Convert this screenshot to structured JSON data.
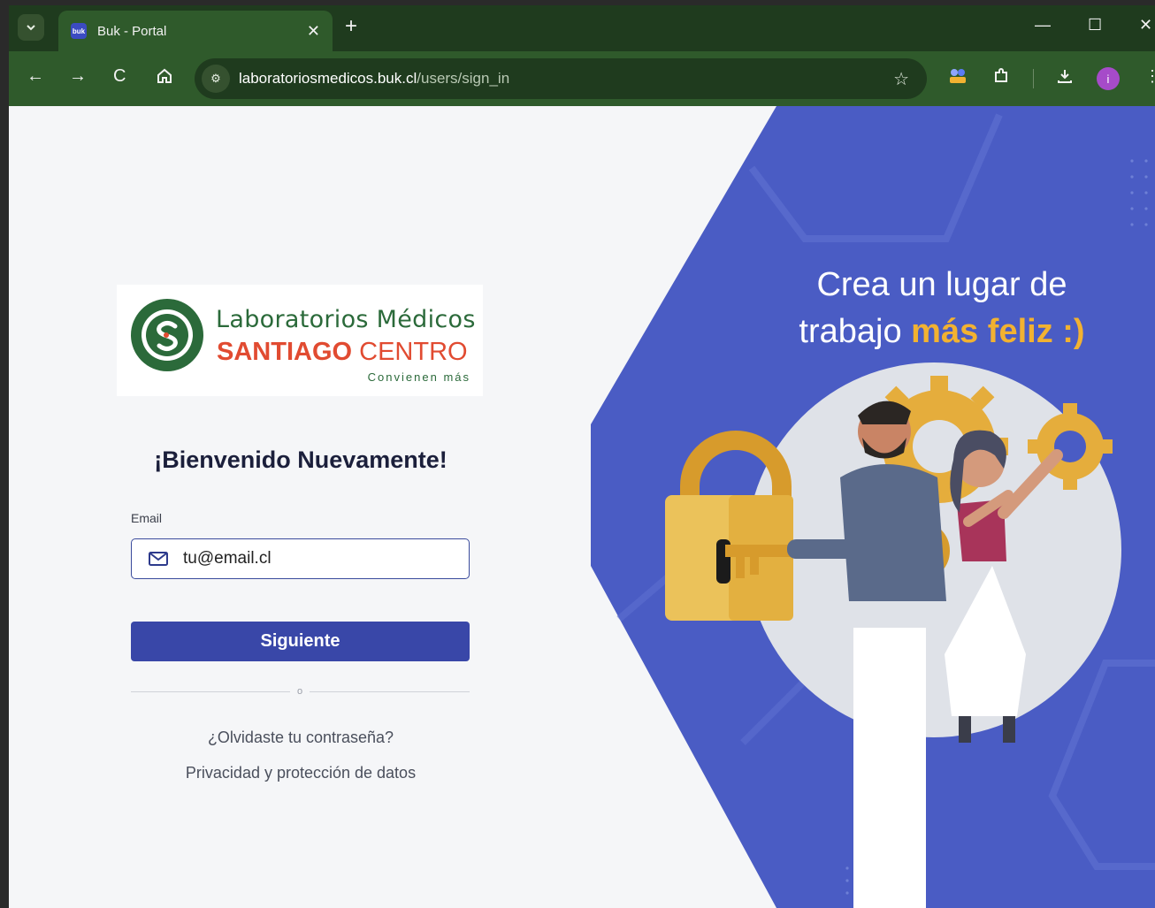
{
  "browser": {
    "tab_title": "Buk - Portal",
    "favicon_text": "buk",
    "url_domain": "laboratoriosmedicos.buk.cl",
    "url_path": "/users/sign_in",
    "profile_initial": "i"
  },
  "logo": {
    "line1": "Laboratorios Médicos",
    "line2_bold": "SANTIAGO",
    "line2_rest": " CENTRO",
    "tagline": "Convienen más"
  },
  "login": {
    "title": "¡Bienvenido Nuevamente!",
    "email_label": "Email",
    "email_placeholder": "tu@email.cl",
    "next_button": "Siguiente",
    "divider_text": "o",
    "forgot_link": "¿Olvidaste tu contraseña?",
    "privacy_link": "Privacidad y protección de datos"
  },
  "promo": {
    "line1": "Crea un lugar de",
    "line2_plain": "trabajo ",
    "line2_accent": "más feliz :)"
  },
  "colors": {
    "chrome_dark": "#1f3b1e",
    "chrome_green": "#2f5a2b",
    "primary": "#3947a8",
    "promo_blue": "#4a5cc4",
    "accent_yellow": "#f2b231",
    "logo_green": "#2b6a3a",
    "logo_red": "#e14b31"
  }
}
